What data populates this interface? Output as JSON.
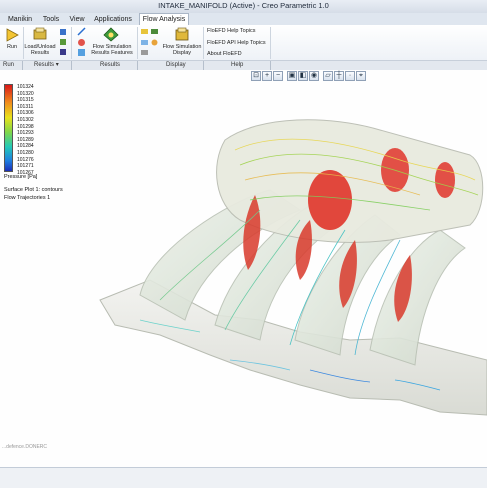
{
  "window": {
    "title": "INTAKE_MANIFOLD (Active) - Creo Parametric 1.0"
  },
  "tabs": [
    "Manikin",
    "Tools",
    "View",
    "Applications",
    "Flow Analysis"
  ],
  "ribbon": {
    "run_label": "Run",
    "load_unload": [
      "Load/Unload",
      "Results"
    ],
    "flow_sim_features": [
      "Flow Simulation",
      "Results Features"
    ],
    "flow_sim_display": [
      "Flow Simulation",
      "Display"
    ],
    "help_items": [
      "FloEFD Help Topics",
      "FloEFD API Help Topics",
      "About FloEFD"
    ]
  },
  "groups": {
    "run": "Run",
    "results_menu": "Results",
    "results": "Results",
    "display": "Display",
    "help": "Help"
  },
  "legend": {
    "values": [
      "101324",
      "101320",
      "101315",
      "101311",
      "101306",
      "101302",
      "101298",
      "101293",
      "101289",
      "101284",
      "101280",
      "101276",
      "101271",
      "101267"
    ],
    "unit_label": "Pressure [Pa]",
    "colors": [
      "#d81818",
      "#f08a1c",
      "#e8e21c",
      "#7fd64a",
      "#23c9b8",
      "#1f7fe0",
      "#1c2fb8"
    ]
  },
  "captions": {
    "surface_plot": "Surface Plot 1: contours",
    "flow_traj": "Flow Trajectories 1"
  },
  "watermark": "...defence.DONERC"
}
